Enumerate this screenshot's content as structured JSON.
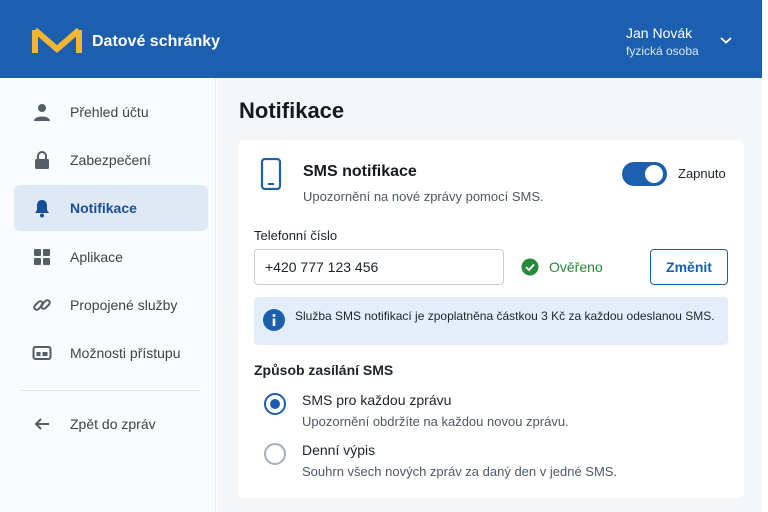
{
  "header": {
    "app_title": "Datové schránky",
    "user_name": "Jan Novák",
    "user_role": "fyzická osoba",
    "logo_icon": "envelope-logo",
    "brand_color": "#1b5fae",
    "logo_color": "#f2b632"
  },
  "sidebar": {
    "items": [
      {
        "label": "Přehled účtu",
        "icon": "user-icon"
      },
      {
        "label": "Zabezpečení",
        "icon": "lock-icon"
      },
      {
        "label": "Notifikace",
        "icon": "bell-icon",
        "active": true
      },
      {
        "label": "Aplikace",
        "icon": "grid-icon"
      },
      {
        "label": "Propojené služby",
        "icon": "link-icon"
      },
      {
        "label": "Možnosti přístupu",
        "icon": "access-card-icon"
      }
    ],
    "back_label": "Zpět do zpráv"
  },
  "main": {
    "title": "Notifikace",
    "sms": {
      "title": "SMS notifikace",
      "description": "Upozornění na nové zprávy pomocí SMS.",
      "toggle_label": "Zapnuto",
      "enabled": true
    },
    "phone": {
      "label": "Telefonní číslo",
      "value": "+420 777 123 456",
      "verified_text": "Ověřeno",
      "change_label": "Změnit"
    },
    "info_text": "Služba SMS notifikací je zpoplatněna částkou 3 Kč za každou odeslanou SMS.",
    "delivery": {
      "title": "Způsob zasílání SMS",
      "options": [
        {
          "label": "SMS pro každou zprávu",
          "description": "Upozornění obdržíte na každou novou zprávu.",
          "selected": true
        },
        {
          "label": "Denní výpis",
          "description": "Souhrn všech nových zpráv za daný den v jedné SMS.",
          "selected": false
        }
      ]
    }
  }
}
